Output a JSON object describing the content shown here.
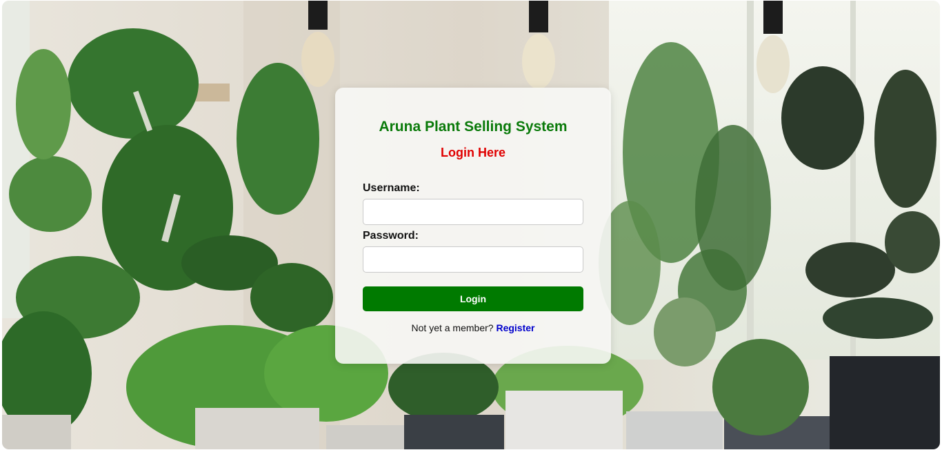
{
  "app": {
    "title": "Aruna Plant Selling System",
    "subtitle": "Login Here"
  },
  "form": {
    "username_label": "Username:",
    "username_value": "",
    "password_label": "Password:",
    "password_value": "",
    "login_label": "Login",
    "footer_text": "Not yet a member?",
    "register_label": "Register"
  },
  "background": {
    "description_icon": "houseplants-photo"
  },
  "colors": {
    "title": "#0a7a0a",
    "subtitle": "#e00000",
    "button": "#007a00",
    "link": "#0000cc",
    "wall": "#ddd7cc",
    "window": "#eef0e8"
  }
}
